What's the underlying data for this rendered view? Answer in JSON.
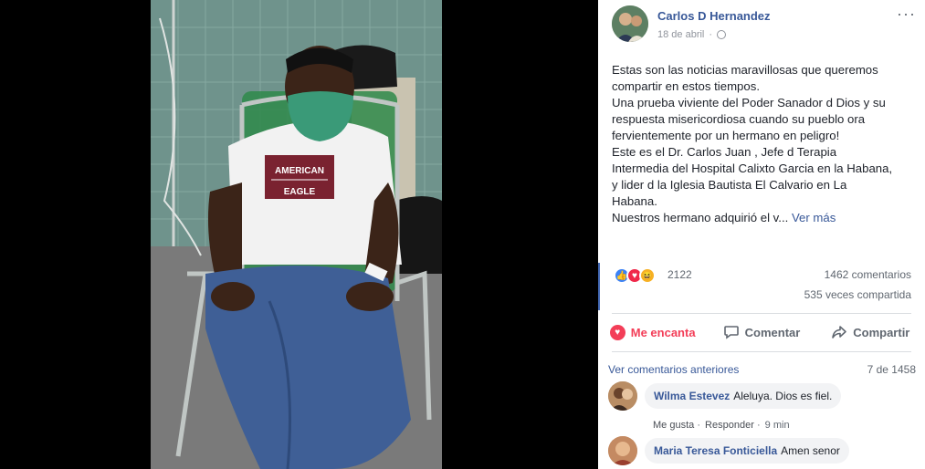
{
  "post": {
    "author": "Carlos D Hernandez",
    "date": "18 de abril",
    "more_glyph": "···",
    "lines": [
      "Estas son las noticias maravillosas que queremos",
      "compartir en estos tiempos.",
      "Una prueba viviente del Poder Sanador d Dios y su",
      "respuesta misericordiosa cuando su pueblo ora",
      "fervientemente por un hermano en peligro!",
      "Este es el Dr. Carlos Juan , Jefe d Terapia",
      "Intermedia del Hospital Calixto Garcia en la Habana,",
      "y lider d la Iglesia Bautista El Calvario en La",
      "Habana.",
      "Nuestros hermano adquirió el v..."
    ],
    "see_more": "Ver más"
  },
  "photo": {
    "shirt_text_top": "AMERICAN",
    "shirt_text_bottom": "EAGLE"
  },
  "reactions": {
    "icons": [
      "like-icon",
      "love-icon",
      "haha-icon"
    ],
    "count": "2122",
    "comments": "1462 comentarios",
    "shares": "535 veces compartida"
  },
  "actions": {
    "love": "Me encanta",
    "comment": "Comentar",
    "share": "Compartir"
  },
  "comments_section": {
    "prev_label": "Ver comentarios anteriores",
    "count": "7 de 1458",
    "comments": [
      {
        "name": "Wilma Estevez",
        "text": "Aleluya. Dios es fiel.",
        "like": "Me gusta",
        "reply": "Responder",
        "time": "9 min",
        "sep": "·"
      },
      {
        "name": "Maria Teresa Fonticiella",
        "text": "Amen senor"
      }
    ]
  },
  "colors": {
    "accent": "#385898",
    "love": "#f33e58",
    "like": "#3b82f6",
    "mask": "#3a9a78"
  }
}
